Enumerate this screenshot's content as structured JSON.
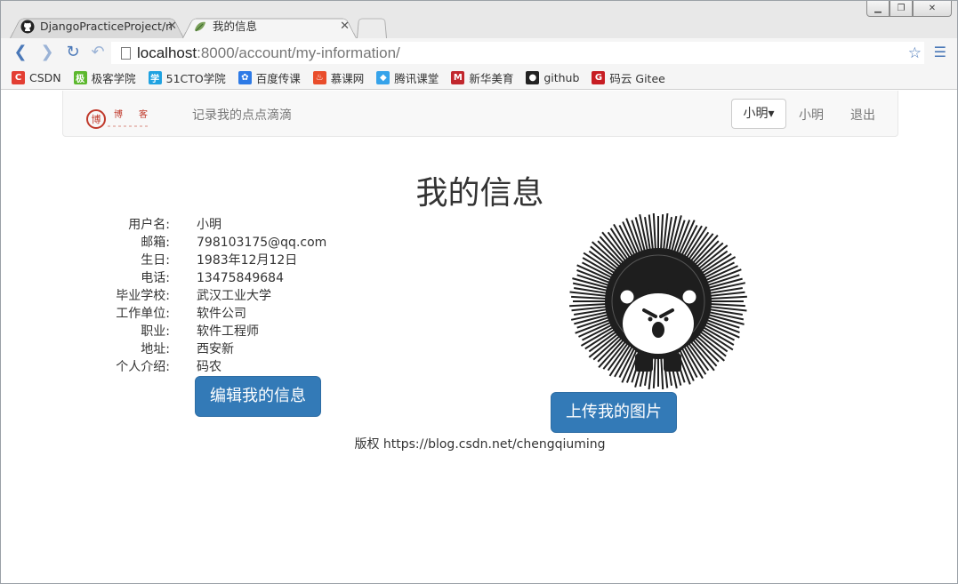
{
  "browser": {
    "tabs": [
      {
        "title": "DjangoPracticeProject/n"
      },
      {
        "title": "我的信息"
      }
    ],
    "url_host": "localhost",
    "url_rest": ":8000/account/my-information/",
    "bookmarks": [
      {
        "label": "CSDN",
        "icon": "C",
        "color": "#e33e33"
      },
      {
        "label": "极客学院",
        "icon": "极",
        "color": "#5cb82e"
      },
      {
        "label": "51CTO学院",
        "icon": "学",
        "color": "#1fa2e1"
      },
      {
        "label": "百度传课",
        "icon": "✿",
        "color": "#2d7ae6"
      },
      {
        "label": "慕课网",
        "icon": "♨",
        "color": "#e94d2b"
      },
      {
        "label": "腾讯课堂",
        "icon": "◆",
        "color": "#36a3ea"
      },
      {
        "label": "新华美育",
        "icon": "M",
        "color": "#c1272d"
      },
      {
        "label": "github",
        "icon": "●",
        "color": "#222222"
      },
      {
        "label": "码云 Gitee",
        "icon": "G",
        "color": "#c71d23"
      }
    ]
  },
  "navbar": {
    "slogan": "记录我的点点滴滴",
    "user_dropdown": "小明▾",
    "user_link": "小明",
    "logout": "退出"
  },
  "page": {
    "title": "我的信息",
    "fields": [
      {
        "key": "用户名:",
        "value": "小明"
      },
      {
        "key": "邮箱:",
        "value": "798103175@qq.com"
      },
      {
        "key": "生日:",
        "value": "1983年12月12日"
      },
      {
        "key": "电话:",
        "value": "13475849684"
      },
      {
        "key": "毕业学校:",
        "value": "武汉工业大学"
      },
      {
        "key": "工作单位:",
        "value": "软件公司"
      },
      {
        "key": "职业:",
        "value": "软件工程师"
      },
      {
        "key": "地址:",
        "value": "西安新"
      },
      {
        "key": "个人介绍:",
        "value": "码农"
      }
    ],
    "edit_button": "编辑我的信息",
    "upload_button": "上传我的图片",
    "footer": "版权 https://blog.csdn.net/chengqiuming"
  }
}
